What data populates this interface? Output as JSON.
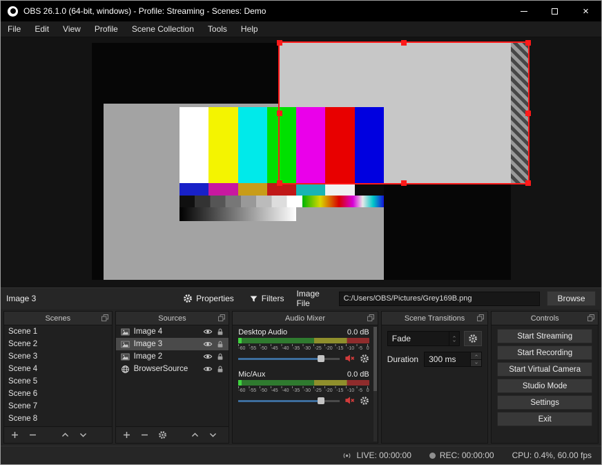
{
  "window": {
    "title": "OBS 26.1.0 (64-bit, windows) - Profile: Streaming - Scenes: Demo"
  },
  "menu": {
    "items": [
      "File",
      "Edit",
      "View",
      "Profile",
      "Scene Collection",
      "Tools",
      "Help"
    ]
  },
  "source_toolbar": {
    "selected_source": "Image 3",
    "properties": "Properties",
    "filters": "Filters",
    "image_file_label": "Image File",
    "image_file_path": "C:/Users/OBS/Pictures/Grey169B.png",
    "browse": "Browse"
  },
  "panels": {
    "scenes": {
      "title": "Scenes",
      "items": [
        "Scene 1",
        "Scene 2",
        "Scene 3",
        "Scene 4",
        "Scene 5",
        "Scene 6",
        "Scene 7",
        "Scene 8"
      ]
    },
    "sources": {
      "title": "Sources",
      "items": [
        {
          "name": "Image 4",
          "icon": "image",
          "selected": false
        },
        {
          "name": "Image 3",
          "icon": "image",
          "selected": true
        },
        {
          "name": "Image 2",
          "icon": "image",
          "selected": false
        },
        {
          "name": "BrowserSource",
          "icon": "globe",
          "selected": false
        }
      ]
    },
    "audio_mixer": {
      "title": "Audio Mixer",
      "channels": [
        {
          "name": "Desktop Audio",
          "level": "0.0 dB"
        },
        {
          "name": "Mic/Aux",
          "level": "0.0 dB"
        }
      ],
      "scale": [
        "-60",
        "-55",
        "-50",
        "-45",
        "-40",
        "-35",
        "-30",
        "-25",
        "-20",
        "-15",
        "-10",
        "-5",
        "0"
      ]
    },
    "transitions": {
      "title": "Scene Transitions",
      "selected_transition": "Fade",
      "duration_label": "Duration",
      "duration_value": "300 ms"
    },
    "controls": {
      "title": "Controls",
      "buttons": [
        "Start Streaming",
        "Start Recording",
        "Start Virtual Camera",
        "Studio Mode",
        "Settings",
        "Exit"
      ]
    }
  },
  "status_bar": {
    "live": "LIVE: 00:00:00",
    "rec": "REC: 00:00:00",
    "stats": "CPU: 0.4%, 60.00 fps"
  },
  "preview": {
    "bar_colors": [
      "#ffffff",
      "#f4f400",
      "#00eaea",
      "#00e000",
      "#ea00ea",
      "#e80000",
      "#0000e0"
    ],
    "castellation_colors": [
      "#1821c8",
      "#c818a0",
      "#c89c18",
      "#c01818",
      "#18b4b4",
      "#f0f0f0",
      "#0c0c0c"
    ]
  }
}
